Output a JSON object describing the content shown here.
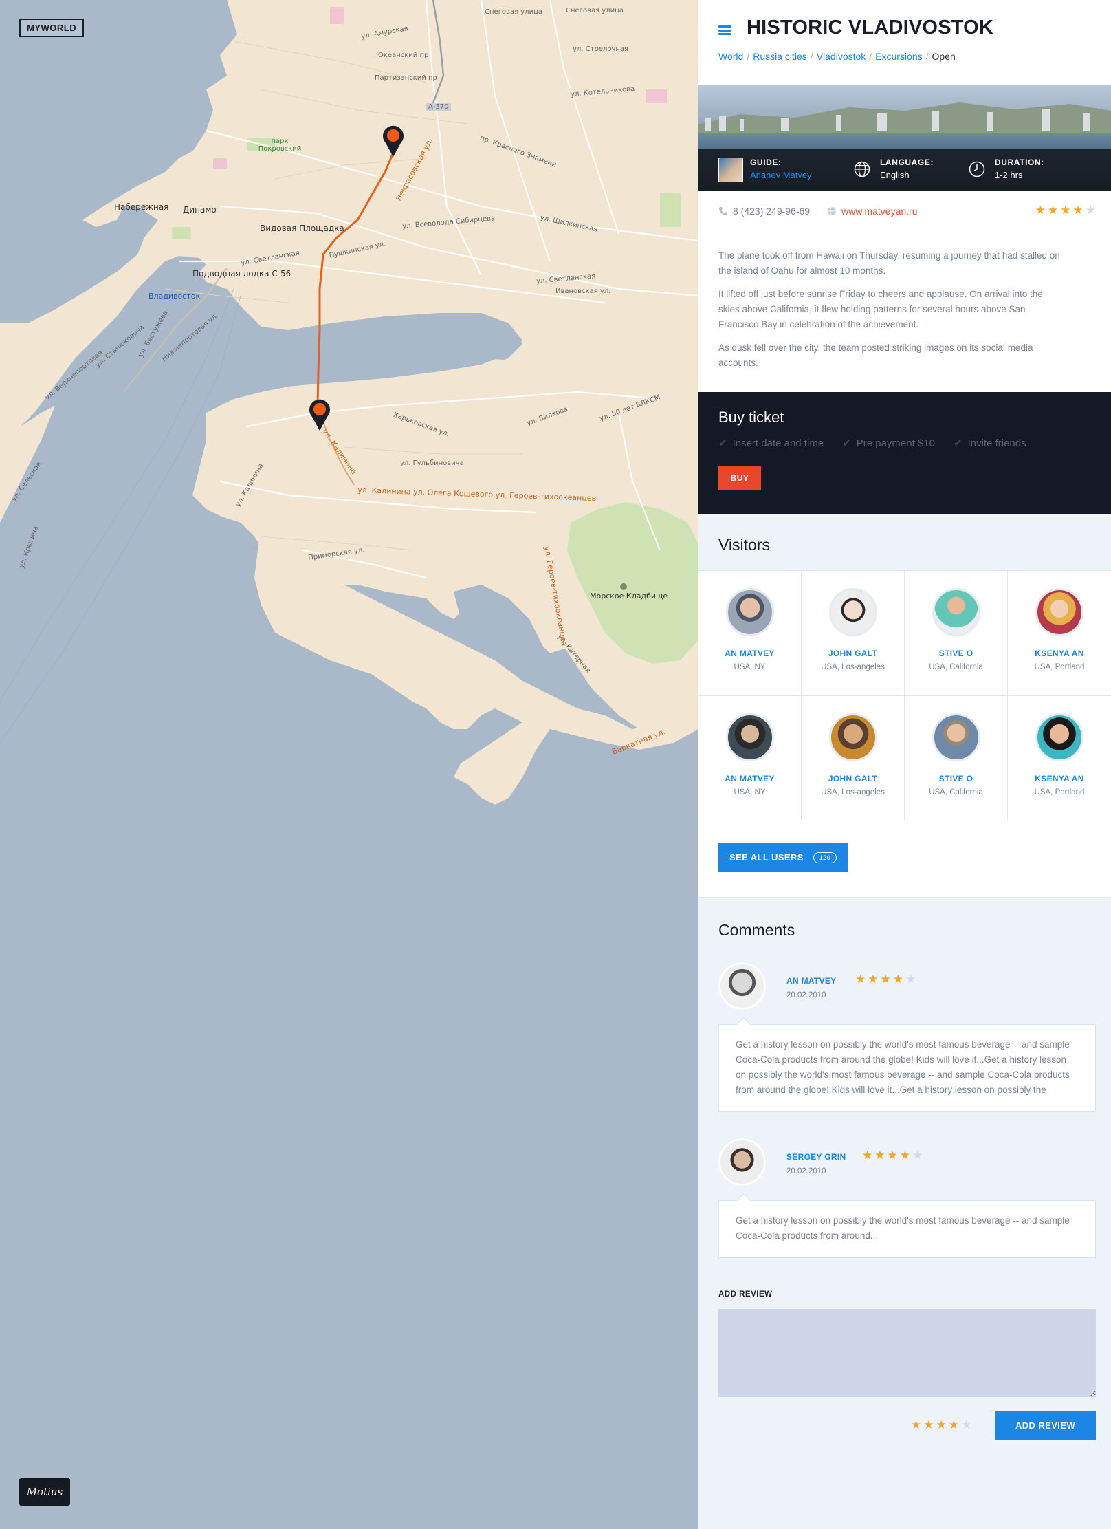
{
  "map": {
    "logo": "MYWORLD",
    "brand": "Motius",
    "labels": [
      {
        "text": "Снеговая улица",
        "cls": "small"
      },
      {
        "text": "Снеговая улица",
        "cls": "small"
      },
      {
        "text": "ул. Амурская",
        "cls": "small"
      },
      {
        "text": "Океанский пр",
        "cls": "small"
      },
      {
        "text": "ул. Стрелочная",
        "cls": "small"
      },
      {
        "text": "Партизанский пр",
        "cls": "small"
      },
      {
        "text": "А-370",
        "cls": "small"
      },
      {
        "text": "ул. Котельникова",
        "cls": "small"
      },
      {
        "text": "ул. Шилкинская",
        "cls": "small"
      },
      {
        "text": "парк Покровский",
        "cls": "park"
      },
      {
        "text": "Некрасовская ул.",
        "cls": "road"
      },
      {
        "text": "пр. Красного Знамени",
        "cls": "small"
      },
      {
        "text": "Набережная",
        "cls": "bold"
      },
      {
        "text": "Динамо",
        "cls": "bold"
      },
      {
        "text": "Видовая Площадка",
        "cls": "bold"
      },
      {
        "text": "ул. Всеволода Сибирцева",
        "cls": "small"
      },
      {
        "text": "Пушкинская ул.",
        "cls": "small"
      },
      {
        "text": "ул. Светланская",
        "cls": "small"
      },
      {
        "text": "Подводная лодка С-56",
        "cls": "bold"
      },
      {
        "text": "Владивосток",
        "cls": "station"
      },
      {
        "text": "ул. Светланская",
        "cls": "small"
      },
      {
        "text": "Ивановская ул.",
        "cls": "small"
      },
      {
        "text": "ул. Калинина",
        "cls": "road"
      },
      {
        "text": "ул. Калинина ул. Олега Кошевого ул. Героев-тихоокеанцев",
        "cls": "road"
      },
      {
        "text": "Харьковская ул.",
        "cls": "small"
      },
      {
        "text": "ул. Гульбиновича",
        "cls": "small"
      },
      {
        "text": "ул. Вилкова",
        "cls": "small"
      },
      {
        "text": "ул. 50 лет ВЛКСМ",
        "cls": "small"
      },
      {
        "text": "Приморская ул.",
        "cls": "small"
      },
      {
        "text": "Морское Кладбище",
        "cls": "bold"
      },
      {
        "text": "ул. Героев-тихоокеанцев",
        "cls": "road"
      },
      {
        "text": "Баркатная ул.",
        "cls": "road"
      },
      {
        "text": "ул. Сельская",
        "cls": "small"
      },
      {
        "text": "ул. Крыгина",
        "cls": "small"
      },
      {
        "text": "ул. Верхнепортовая",
        "cls": "small"
      },
      {
        "text": "ул. Бестужева",
        "cls": "small"
      },
      {
        "text": "Нижнепортовая ул.",
        "cls": "small"
      },
      {
        "text": "ул. Станюковича",
        "cls": "small"
      },
      {
        "text": "ул. Калинина",
        "cls": "small"
      },
      {
        "text": "ул. Катерная",
        "cls": "small"
      }
    ]
  },
  "header": {
    "title": "HISTORIC VLADIVOSTOK",
    "breadcrumbs": [
      "World",
      "Russia cities",
      "Vladivostok",
      "Excursions"
    ],
    "breadcrumb_current": "Open"
  },
  "hero": {
    "guide_label": "GUIDE:",
    "guide_value": "Ananev Matvey",
    "language_label": "LANGUAGE:",
    "language_value": "English",
    "duration_label": "DURATION:",
    "duration_value": "1-2 hrs"
  },
  "contact": {
    "phone": "8 (423) 249-96-69",
    "website": "www.matveyan.ru",
    "rating": 4
  },
  "description": [
    "The plane took off from Hawaii on Thursday, resuming a journey that had stalled on the island of Oahu for almost 10 months.",
    "It lifted off just before sunrise Friday to cheers and applause. On arrival into the skies above California, it flew holding patterns for several hours above San Francisco Bay in celebration of the achievement.",
    "As dusk fell over the city, the team posted striking images on its social media accounts."
  ],
  "buy": {
    "title": "Buy ticket",
    "checks": [
      "Insert date and time",
      "Pre payment $10",
      "Invite friends"
    ],
    "button": "BUY"
  },
  "visitors": {
    "title": "Visitors",
    "items": [
      {
        "name": "AN MATVEY",
        "location": "USA, NY"
      },
      {
        "name": "JOHN GALT",
        "location": "USA, Los-angeles"
      },
      {
        "name": "STIVE O",
        "location": "USA, California"
      },
      {
        "name": "KSENYA AN",
        "location": "USA, Portland"
      },
      {
        "name": "AN MATVEY",
        "location": "USA, NY"
      },
      {
        "name": "JOHN GALT",
        "location": "USA, Los-angeles"
      },
      {
        "name": "STIVE O",
        "location": "USA, California"
      },
      {
        "name": "KSENYA AN",
        "location": "USA, Portland"
      }
    ],
    "see_all": "SEE ALL USERS",
    "count": "120"
  },
  "comments": {
    "title": "Comments",
    "items": [
      {
        "name": "AN MATVEY",
        "date": "20.02.2010",
        "rating": 4,
        "text": "Get a history lesson on possibly the world's most famous beverage -- and sample Coca-Cola products from around the globe! Kids will love it...Get a history lesson on possibly the world's most famous beverage -- and sample Coca-Cola products from around the globe! Kids will love it...Get a history lesson on possibly the"
      },
      {
        "name": "SERGEY GRIN",
        "date": "20.02.2010",
        "rating": 4,
        "text": "Get a history lesson on possibly the world's most famous beverage -- and sample Coca-Cola products from around..."
      }
    ],
    "add_label": "ADD REVIEW",
    "add_button": "ADD REVIEW",
    "add_rating": 4
  },
  "colors": {
    "accent": "#1b86e3",
    "buy_button": "#e8472c",
    "dark_panel": "#141925",
    "star": "#f5a623",
    "route": "#e8601c",
    "land": "#f2e6d3",
    "water": "#a9b9ca"
  }
}
